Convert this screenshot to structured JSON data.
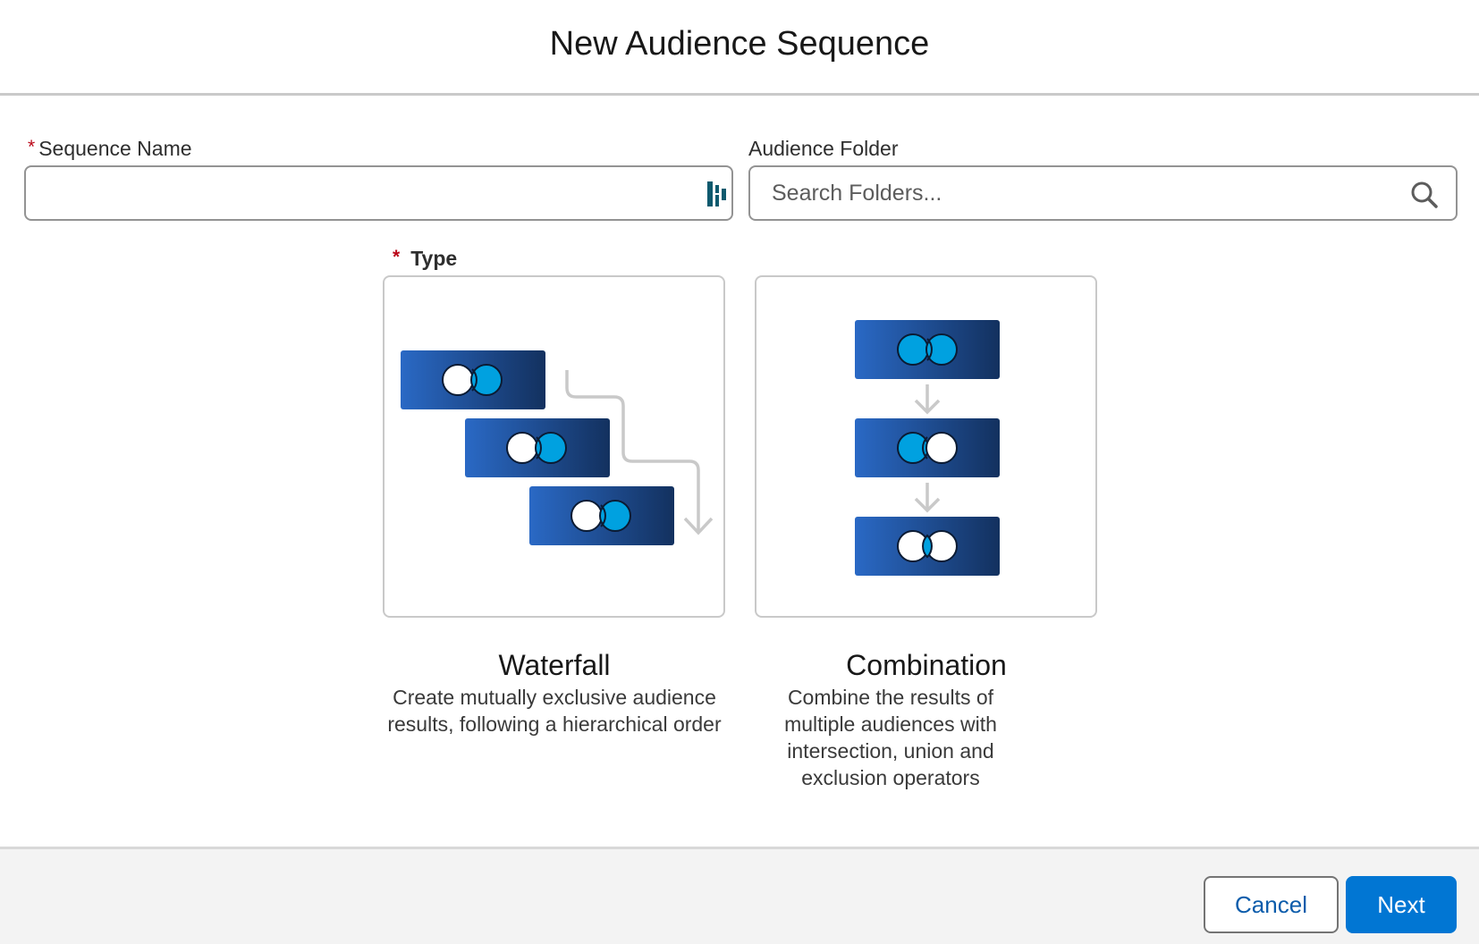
{
  "modal": {
    "title": "New Audience Sequence"
  },
  "form": {
    "sequence_name": {
      "required_mark": "*",
      "label": "Sequence Name",
      "value": "",
      "placeholder": ""
    },
    "audience_folder": {
      "label": "Audience Folder",
      "value": "",
      "placeholder": "Search Folders..."
    },
    "type": {
      "required_mark": "*",
      "label": "Type",
      "options": [
        {
          "title": "Waterfall",
          "description": "Create mutually exclusive audience results, following a hierarchical order"
        },
        {
          "title": "Combination",
          "description": "Combine the results of multiple audiences with intersection, union and exclusion operators"
        }
      ]
    }
  },
  "footer": {
    "cancel_label": "Cancel",
    "next_label": "Next"
  },
  "icons": {
    "sequence_name_field": "record-lookup-icon",
    "folder_search": "search-icon",
    "waterfall_illustration": "waterfall-illustration",
    "combination_illustration": "combination-illustration"
  },
  "colors": {
    "accent": "#0176d3",
    "required": "#ba0517",
    "block_gradient_start": "#2a69c5",
    "block_gradient_end": "#13315f",
    "venn_fill": "#00a1e0"
  }
}
